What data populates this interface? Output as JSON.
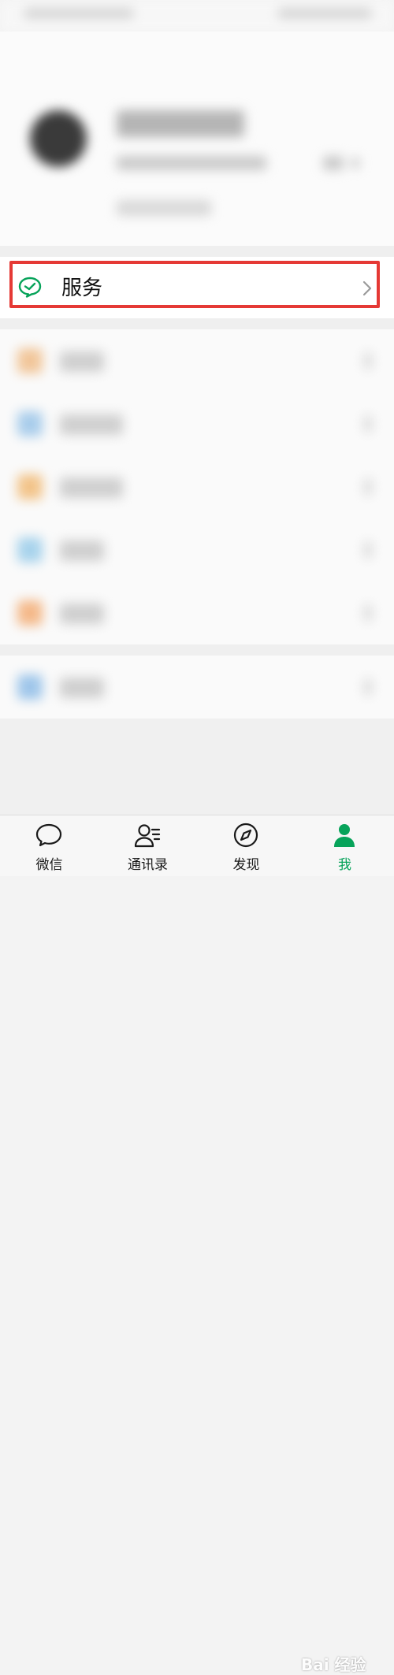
{
  "service": {
    "label": "服务"
  },
  "tabs": [
    {
      "id": "chats",
      "label": "微信"
    },
    {
      "id": "contacts",
      "label": "通讯录"
    },
    {
      "id": "discover",
      "label": "发现"
    },
    {
      "id": "me",
      "label": "我"
    }
  ],
  "colors": {
    "accent": "#07a35a",
    "highlight_box": "#e53935"
  },
  "watermark": "Bai 经验"
}
